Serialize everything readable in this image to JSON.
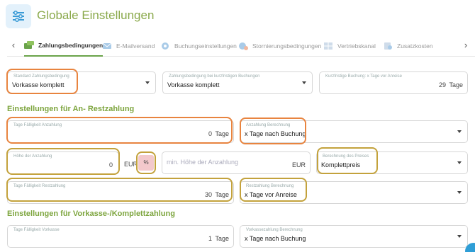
{
  "header": {
    "title": "Globale Einstellungen"
  },
  "tabs": [
    {
      "label": "Zahlungsbedingungen",
      "icon": "payment-icon",
      "active": true
    },
    {
      "label": "E-Mailversand",
      "icon": "mail-icon"
    },
    {
      "label": "Buchungseinstellungen",
      "icon": "gear-icon"
    },
    {
      "label": "Stornierungsbedingungen",
      "icon": "gear-cancel-icon"
    },
    {
      "label": "Vertriebskanal",
      "icon": "grid-icon"
    },
    {
      "label": "Zusatzkosten",
      "icon": "costs-icon"
    }
  ],
  "row1": {
    "standard": {
      "label": "Standard Zahlungsbedingung",
      "value": "Vorkasse komplett"
    },
    "kurzfristig": {
      "label": "Zahlungsbedingung bei kurzfristigen Buchungen",
      "value": "Vorkasse komplett"
    },
    "tage_vor_anreise": {
      "label": "Kurzfristige Buchung: x Tage vor Anreise",
      "value": "29",
      "unit": "Tage"
    }
  },
  "section1": {
    "title": "Einstellungen für An- Restzahlung"
  },
  "anzahlung": {
    "faelligkeit": {
      "label": "Tage Fälligkeit Anzahlung",
      "value": "0",
      "unit": "Tage"
    },
    "berechnung": {
      "label": "Anzahlung Berechnung",
      "value": "x Tage nach Buchung"
    },
    "hoehe": {
      "label": "Höhe der Anzahlung",
      "value": "0"
    },
    "eur_unit": "EUR",
    "pct_unit": "%",
    "min_hoehe": {
      "placeholder": "min. Höhe der Anzahlung",
      "unit": "EUR"
    },
    "preis_berechnung": {
      "label": "Berechnung des Preises",
      "value": "Komplettpreis"
    },
    "rest_faelligkeit": {
      "label": "Tage Fälligkeit Restzahlung",
      "value": "30",
      "unit": "Tage"
    },
    "rest_berechnung": {
      "label": "Restzahlung Berechnung",
      "value": "x Tage vor Anreise"
    }
  },
  "section2": {
    "title": "Einstellungen für Vorkasse-/Komplettzahlung"
  },
  "vorkasse": {
    "faelligkeit": {
      "label": "Tage Fälligkeit Vorkasse",
      "value": "1",
      "unit": "Tage"
    },
    "berechnung": {
      "label": "Vorkassezahlung Berechnung",
      "value": "x Tage nach Buchung"
    }
  }
}
